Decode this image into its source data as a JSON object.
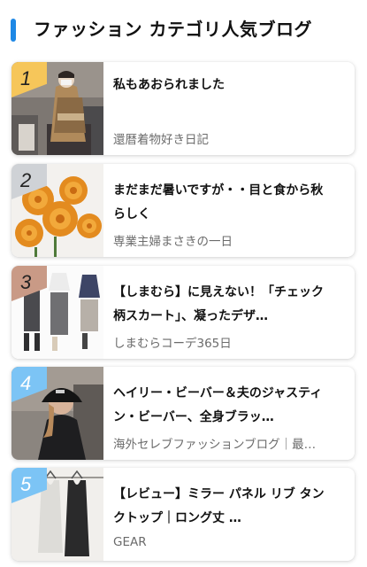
{
  "header": {
    "title": "ファッション カテゴリ人気ブログ",
    "accent_color": "#1e88e5"
  },
  "items": [
    {
      "rank": "1",
      "rank_color": "#f6c65a",
      "title": "私もあおられました",
      "blog": "還暦着物好き日記",
      "thumbnail": "woman-in-kimono-photo"
    },
    {
      "rank": "2",
      "rank_color": "#cfd2d6",
      "title": "まだまだ暑いですが・・目と食から秋らしく",
      "blog": "専業主婦まさきの一日",
      "thumbnail": "orange-chrysanthemum-photo"
    },
    {
      "rank": "3",
      "rank_color": "#c99a86",
      "title": "【しまむら】に見えない！「チェック柄スカート」、凝ったデザ…",
      "blog": "しまむらコーデ365日",
      "thumbnail": "outfit-collage-photo"
    },
    {
      "rank": "4",
      "rank_color": "#7cc4f5",
      "title": "ヘイリー・ビーバー＆夫のジャスティン・ビーバー、全身ブラッ…",
      "blog": "海外セレブファッションブログ｜最…",
      "thumbnail": "woman-in-bucket-hat-photo"
    },
    {
      "rank": "5",
      "rank_color": "#7cc4f5",
      "title": "【レビュー】ミラー パネル リブ タンクトップ｜ロング丈 …",
      "blog": "GEAR",
      "thumbnail": "tank-tops-on-hangers-photo"
    }
  ]
}
